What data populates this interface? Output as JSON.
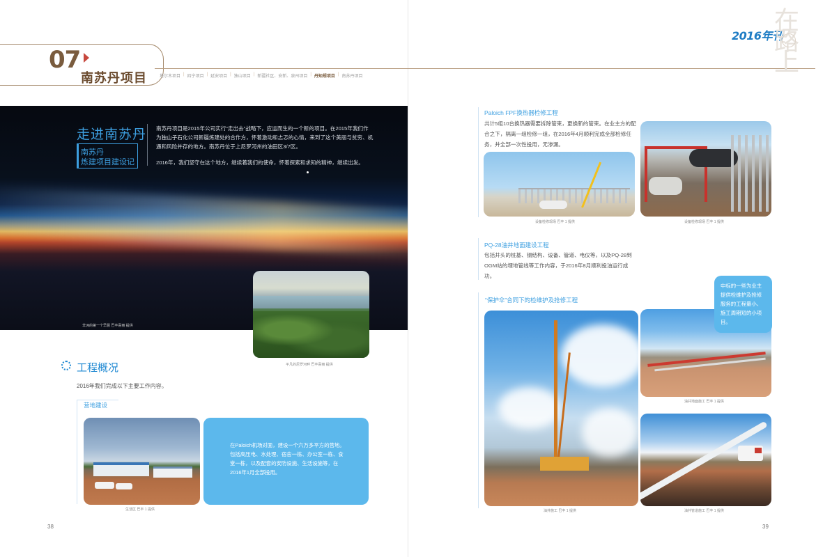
{
  "header": {
    "chapter_number": "07",
    "chapter_title": "南苏丹项目",
    "nav_items": [
      "塔尔木项目",
      "四宁项目",
      "延安项目",
      "独山项目",
      "新疆社区、安新、泉州项目",
      "丹知规项目",
      "南苏丹项目"
    ],
    "nav_active_index": 5,
    "logo_year": "2016年刊",
    "logo_calligraphy": "在路上"
  },
  "left_page": {
    "hero": {
      "title": "走进南苏丹",
      "subtitle_line1": "南苏丹",
      "subtitle_line2": "炼建项目建设记",
      "paragraph1": "南苏丹项目是2015年公司实行“走出去”战略下，应运而生的一个新的项目。在2015年我们作为独山子石化公司新疆炼建处的合作方，怀着激动和忐忑的心情，来到了这个美丽与贫穷、机遇和风险并存的地方。南苏丹位于上尼罗河州的油田区3/7区。",
      "paragraph2": "2016年，我们坚守在这个地方，继续着我们的使命，怀着探索和求知的精神，继续出发。",
      "caption": "非洲的第一个早晨 巴丰喜丽 提供"
    },
    "river_caption": "平凡的尼罗河畔 巴丰喜丽 提供",
    "section": {
      "title": "工程概况",
      "intro": "2016年我们完成以下主要工作内容。",
      "sub_title": "营地建设",
      "camp_caption": "生活区 巴丰 1 提供",
      "camp_text": "在Paloich机场对面，建设一个六万多平方的营地。包括高压电、水处理、宿舍一栋、办公室一栋、食堂一栋，以及配套的安防设施、生活设施等，在2016年1月全部投用。"
    },
    "page_number": "38"
  },
  "right_page": {
    "block1": {
      "title": "Paloich FPF换热器检修工程",
      "text": "共计5组10台换热器需要拆除管束，更换新的管束。在业主方的配合之下，隔离一组检修一组，在2016年4月顺利完成全部检修任务，并全部一次性投用，无渗漏。",
      "caption1": "设备检修现场 巴丰 1 提供",
      "caption2": "设备检修现场 巴丰 1 提供"
    },
    "block2": {
      "title": "PQ-28油井地面建设工程",
      "text": "包括井头的桩基、钢结构、设备、管道、电仪等，以及PQ-28到OGM站的埋地管线等工作内容，于2016年8月顺利投油运行成功。"
    },
    "block3": {
      "title": "“保护伞”合同下的检维护及抢修工程",
      "box_text": "中标的一些为业主提供检维护及抢修服务的工程量小、施工周期短的小项目。",
      "caption_rig": "油井施工 巴丰 1 提供",
      "caption_field": "油井地面施工 巴丰 1 提供",
      "caption_pipe": "油井管道施工 巴丰 1 提供"
    },
    "page_number": "39"
  }
}
